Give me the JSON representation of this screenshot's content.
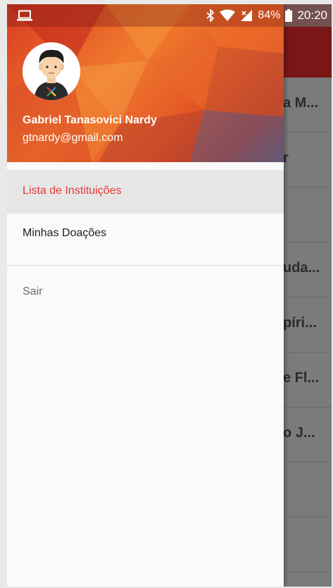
{
  "status_bar": {
    "icons": [
      "laptop-icon",
      "bluetooth-icon",
      "wifi-icon",
      "signal-icon",
      "battery-icon"
    ],
    "battery": "84%",
    "time": "20:20"
  },
  "drawer": {
    "user": {
      "name": "Gabriel Tanasovici Nardy",
      "email": "gtnardy@gmail.com"
    },
    "items": [
      {
        "label": "Lista de Instituições",
        "active": true
      },
      {
        "label": "Minhas Doações",
        "active": false
      },
      {
        "label": "Sair",
        "active": false
      }
    ],
    "active_color": "#e53935"
  },
  "background_list": {
    "rows": [
      "a M...",
      "r",
      "",
      "uda...",
      "píri...",
      "e Fl...",
      "o J...",
      "",
      ""
    ]
  },
  "colors": {
    "toolbar": "#7a1616",
    "header_accent": "#f07a2c"
  }
}
